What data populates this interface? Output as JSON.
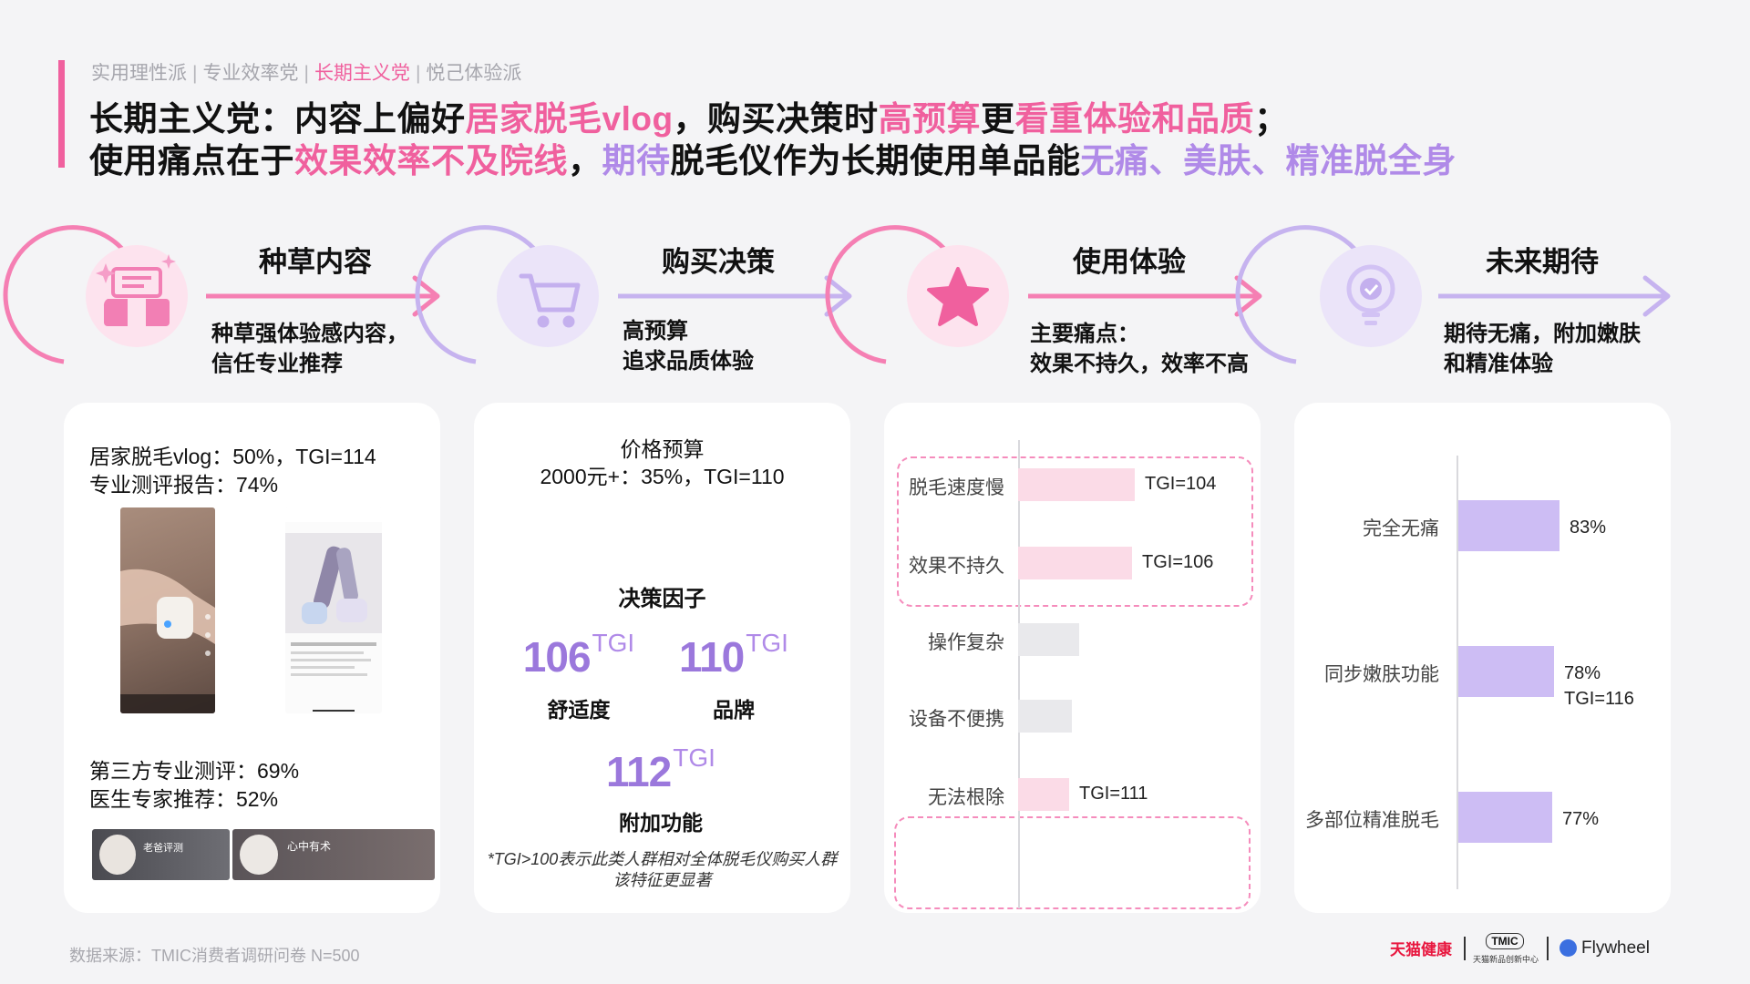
{
  "header": {
    "tabs": [
      "实用理性派",
      "专业效率党",
      "长期主义党",
      "悦己体验派"
    ],
    "tab_separator": "|",
    "headline1": [
      {
        "t": "长期主义党：内容上偏好",
        "c": "dark"
      },
      {
        "t": "居家脱毛vlog",
        "c": "pink"
      },
      {
        "t": "，购买决策时",
        "c": "dark"
      },
      {
        "t": "高预算",
        "c": "pink"
      },
      {
        "t": "更",
        "c": "dark"
      },
      {
        "t": "看重体验和品质",
        "c": "pink"
      },
      {
        "t": "；",
        "c": "dark"
      }
    ],
    "headline2": [
      {
        "t": "使用痛点在于",
        "c": "dark"
      },
      {
        "t": "效果效率不及院线",
        "c": "pink"
      },
      {
        "t": "，",
        "c": "dark"
      },
      {
        "t": "期待",
        "c": "purple"
      },
      {
        "t": "脱毛仪作为长期使用单品能",
        "c": "dark"
      },
      {
        "t": "无痛、美肤、精准脱全身",
        "c": "purple"
      }
    ]
  },
  "stages": [
    {
      "title": "种草内容",
      "desc": "种草强体验感内容，\n信任专业推荐",
      "icon": "thumbs-up-icon"
    },
    {
      "title": "购买决策",
      "desc": "高预算\n追求品质体验",
      "icon": "cart-icon"
    },
    {
      "title": "使用体验",
      "desc": "主要痛点：\n效果不持久，效率不高",
      "icon": "star-icon"
    },
    {
      "title": "未来期待",
      "desc": "期待无痛，附加嫩肤\n和精准体验",
      "icon": "lightbulb-icon"
    }
  ],
  "card1": {
    "stats_top": "居家脱毛vlog：50%，TGI=114\n专业测评报告：74%",
    "stats_bottom": "第三方专业测评：69%\n医生专家推荐：52%",
    "expert1": "老爸评测",
    "expert2": "心中有术"
  },
  "card2": {
    "budget_title": "价格预算",
    "budget_value": "2000元+：35%，TGI=110",
    "factor_title": "决策因子",
    "tgi_unit": "TGI",
    "footnote": "*TGI>100表示此类人群相对全体脱毛仪购买人群\n该特征更显著"
  },
  "chart_data": [
    {
      "type": "bar",
      "orientation": "horizontal",
      "title": "决策因子",
      "categories": [
        "舒适度",
        "品牌",
        "附加功能"
      ],
      "series": [
        {
          "values": [
            106,
            110,
            112
          ]
        }
      ]
    },
    {
      "type": "bar",
      "orientation": "horizontal",
      "categories": [
        "脱毛速度慢",
        "效果不持久",
        "操作复杂",
        "设备不便携",
        "无法根除"
      ],
      "series": [
        {
          "values": [
            null,
            null,
            null,
            null,
            null
          ]
        }
      ],
      "labels": [
        "TGI=104",
        "TGI=106",
        "",
        "",
        "TGI=111"
      ],
      "relative_widths": [
        1.0,
        0.98,
        0.52,
        0.46,
        0.44
      ],
      "highlight": [
        true,
        true,
        false,
        false,
        true
      ],
      "colors": {
        "highlight": "#fbdbe7",
        "normal": "#e9e9ec"
      }
    },
    {
      "type": "bar",
      "orientation": "horizontal",
      "categories": [
        "完全无痛",
        "同步嫩肤功能",
        "多部位精准脱毛"
      ],
      "series": [
        {
          "values": [
            83,
            78,
            77
          ]
        }
      ],
      "labels": [
        "83%",
        "78%\nTGI=116",
        "77%"
      ],
      "color": "#cdbdf4"
    }
  ],
  "footer": {
    "source": "数据来源：TMIC消费者调研问卷 N=500",
    "logo1": "天猫健康",
    "logo2": "TMIC",
    "logo2_sub": "天猫新品创新中心",
    "logo3": "Flywheel"
  },
  "colors": {
    "pink": "#f0609e",
    "purple": "#b08ae8",
    "pink_light": "#fbdbe7",
    "purple_bar": "#cdbdf4"
  }
}
